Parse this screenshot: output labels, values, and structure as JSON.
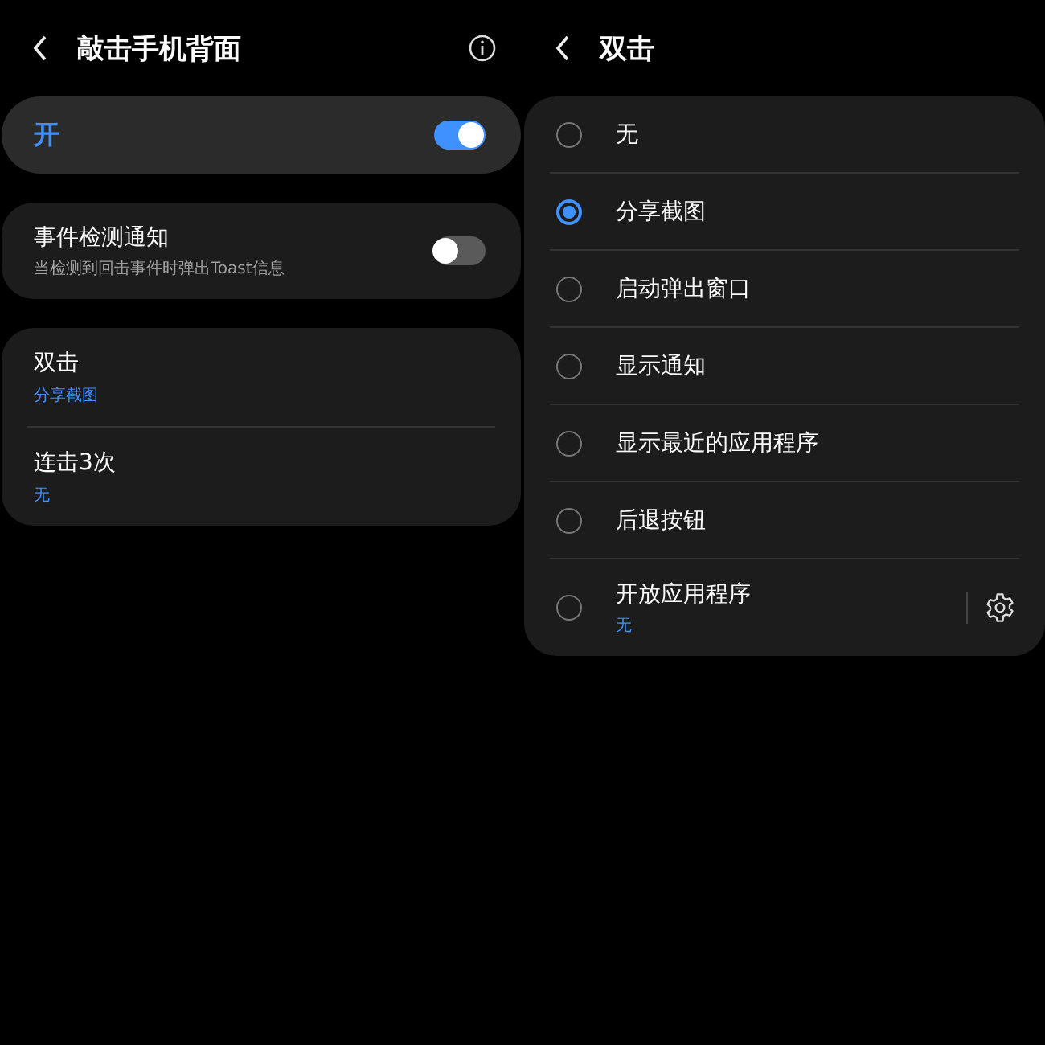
{
  "left": {
    "header": {
      "title": "敲击手机背面"
    },
    "master": {
      "label": "开",
      "on": true
    },
    "notify": {
      "title": "事件检测通知",
      "subtitle": "当检测到回击事件时弹出Toast信息",
      "on": false
    },
    "gestures": [
      {
        "title": "双击",
        "value": "分享截图"
      },
      {
        "title": "连击3次",
        "value": "无"
      }
    ]
  },
  "right": {
    "header": {
      "title": "双击"
    },
    "options": [
      {
        "label": "无",
        "selected": false,
        "kind": "plain"
      },
      {
        "label": "分享截图",
        "selected": true,
        "kind": "plain"
      },
      {
        "label": "启动弹出窗口",
        "selected": false,
        "kind": "plain"
      },
      {
        "label": "显示通知",
        "selected": false,
        "kind": "plain"
      },
      {
        "label": "显示最近的应用程序",
        "selected": false,
        "kind": "plain"
      },
      {
        "label": "后退按钮",
        "selected": false,
        "kind": "plain"
      },
      {
        "label": "开放应用程序",
        "value": "无",
        "selected": false,
        "kind": "app"
      }
    ]
  }
}
